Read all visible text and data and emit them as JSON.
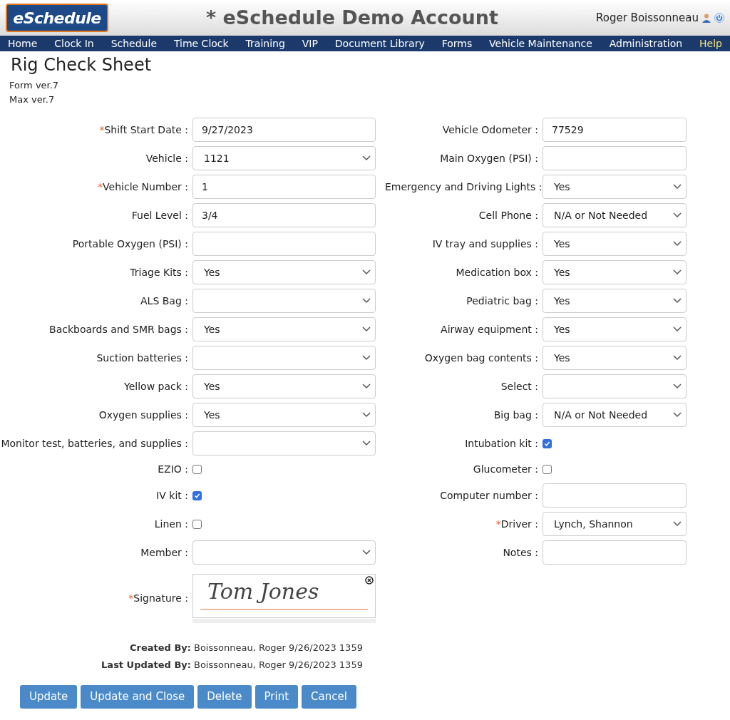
{
  "header": {
    "logo": "eSchedule",
    "title": "* eSchedule Demo Account",
    "user": "Roger Boissonneau"
  },
  "nav": [
    {
      "label": "Home",
      "highlighted": false
    },
    {
      "label": "Clock In",
      "highlighted": false
    },
    {
      "label": "Schedule",
      "highlighted": false
    },
    {
      "label": "Time Clock",
      "highlighted": false
    },
    {
      "label": "Training",
      "highlighted": false
    },
    {
      "label": "VIP",
      "highlighted": false
    },
    {
      "label": "Document Library",
      "highlighted": false
    },
    {
      "label": "Forms",
      "highlighted": false
    },
    {
      "label": "Vehicle Maintenance",
      "highlighted": false
    },
    {
      "label": "Administration",
      "highlighted": false
    },
    {
      "label": "Help",
      "highlighted": true
    }
  ],
  "page_title": "Rig Check Sheet",
  "versions": [
    "Form ver.7",
    "Max ver.7"
  ],
  "rows": [
    {
      "left": {
        "kind": "text",
        "marker": "*",
        "label": "Shift Start Date :",
        "value": "9/27/2023"
      },
      "right": {
        "kind": "text",
        "label": "Vehicle Odometer :",
        "value": "77529"
      }
    },
    {
      "left": {
        "kind": "select",
        "label": "Vehicle :",
        "value": "1121"
      },
      "right": {
        "kind": "text",
        "label": "Main Oxygen (PSI) :"
      }
    },
    {
      "left": {
        "kind": "text",
        "marker": "*",
        "label": "Vehicle Number :",
        "value": "1"
      },
      "right": {
        "kind": "select",
        "label": "Emergency and Driving Lights :",
        "value": "Yes"
      }
    },
    {
      "left": {
        "kind": "text",
        "label": "Fuel Level :",
        "value": "3/4"
      },
      "right": {
        "kind": "select",
        "label": "Cell Phone :",
        "value": "N/A or Not Needed"
      }
    },
    {
      "left": {
        "kind": "text",
        "label": "Portable Oxygen (PSI) :"
      },
      "right": {
        "kind": "select",
        "label": "IV tray and supplies :",
        "value": "Yes"
      }
    },
    {
      "left": {
        "kind": "select",
        "label": "Triage Kits :",
        "value": "Yes"
      },
      "right": {
        "kind": "select",
        "label": "Medication box :",
        "value": "Yes"
      }
    },
    {
      "left": {
        "kind": "select",
        "label": "ALS Bag :"
      },
      "right": {
        "kind": "select",
        "label": "Pediatric bag :",
        "value": "Yes"
      }
    },
    {
      "left": {
        "kind": "select",
        "label": "Backboards and SMR bags :",
        "value": "Yes"
      },
      "right": {
        "kind": "select",
        "label": "Airway equipment :",
        "value": "Yes"
      }
    },
    {
      "left": {
        "kind": "select",
        "label": "Suction batteries :"
      },
      "right": {
        "kind": "select",
        "label": "Oxygen bag contents :",
        "value": "Yes"
      }
    },
    {
      "left": {
        "kind": "select",
        "label": "Yellow pack :",
        "value": "Yes"
      },
      "right": {
        "kind": "select",
        "label": "Select :"
      }
    },
    {
      "left": {
        "kind": "select",
        "label": "Oxygen supplies :",
        "value": "Yes"
      },
      "right": {
        "kind": "select",
        "label": "Big bag :",
        "value": "N/A or Not Needed"
      }
    },
    {
      "left": {
        "kind": "select",
        "label": "Monitor test, batteries, and supplies :"
      },
      "right": {
        "kind": "checkbox",
        "label": "Intubation kit :",
        "checked": true
      }
    },
    {
      "left": {
        "kind": "checkbox",
        "label": "EZIO :",
        "checked": false
      },
      "right": {
        "kind": "checkbox",
        "label": "Glucometer :",
        "checked": false
      }
    },
    {
      "left": {
        "kind": "checkbox",
        "label": "IV kit :",
        "checked": true
      },
      "right": {
        "kind": "text",
        "label": "Computer number :"
      }
    },
    {
      "left": {
        "kind": "checkbox",
        "label": "Linen :",
        "checked": false
      },
      "right": {
        "kind": "select",
        "marker": "*",
        "label": "Driver :",
        "value": "Lynch, Shannon"
      }
    },
    {
      "left": {
        "kind": "select",
        "label": "Member :"
      },
      "right": {
        "kind": "text",
        "label": "Notes :"
      }
    },
    {
      "left": {
        "kind": "signature",
        "marker": "*",
        "label": "Signature :",
        "value": "Tom Jones"
      }
    }
  ],
  "audit": [
    {
      "label": "Created By:",
      "value": "Boissonneau, Roger 9/26/2023 1359"
    },
    {
      "label": "Last Updated By:",
      "value": "Boissonneau, Roger 9/26/2023 1359"
    }
  ],
  "buttons": [
    "Update",
    "Update and Close",
    "Delete",
    "Print",
    "Cancel"
  ]
}
